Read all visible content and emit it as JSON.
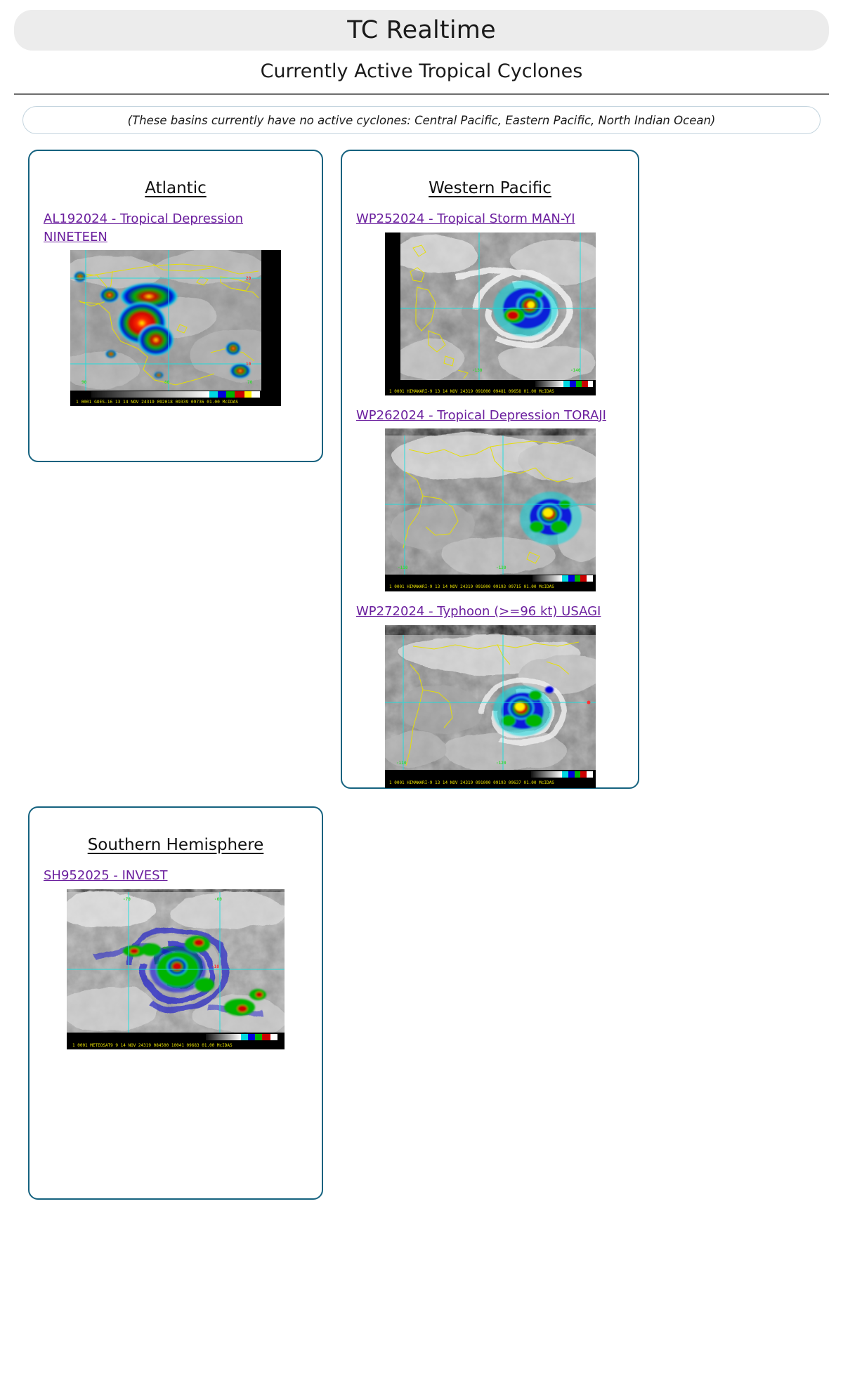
{
  "header": {
    "title": "TC Realtime",
    "subtitle": "Currently Active Tropical Cyclones",
    "note": "(These basins currently have no active cyclones: Central Pacific, Eastern Pacific, North Indian Ocean)"
  },
  "colors": {
    "panel_border": "#15627f",
    "link": "#6b1f9e",
    "title_pill_bg": "#ececec",
    "rule": "#6e6e6e",
    "note_border": "#c3d4de"
  },
  "basins": [
    {
      "id": "atlantic",
      "heading": "Atlantic",
      "storms": [
        {
          "id": "AL192024",
          "link_label": "AL192024 - Tropical Depression NINETEEN",
          "caption": "1 0001  GOES-16      13 14 NOV 24319 092018 09339 09736 01.00      McIDAS",
          "lat_labels": [
            "20",
            "10"
          ],
          "lon_labels": [
            "90",
            "80",
            "70"
          ]
        }
      ]
    },
    {
      "id": "wpac",
      "heading": "Western Pacific",
      "storms": [
        {
          "id": "WP252024",
          "link_label": "WP252024 - Tropical Storm MAN-YI",
          "caption": "1 0001  HIMAWARI-9 13 14 NOV 24319 091000 09481 09658 01.00    McIDAS",
          "lat_labels": [],
          "lon_labels": [
            "-130",
            "-140"
          ]
        },
        {
          "id": "WP262024",
          "link_label": "WP262024 - Tropical Depression TORAJI",
          "caption": "1 0001  HIMAWARI-9 13 14 NOV 24319 091000 09193 09715 01.00    McIDAS",
          "lat_labels": [],
          "lon_labels": [
            "-110",
            "-120"
          ]
        },
        {
          "id": "WP272024",
          "link_label": "WP272024 - Typhoon (>=96 kt) USAGI",
          "caption": "1 0001  HIMAWARI-9 13 14 NOV 24319 091000 09193 09637 01.00    McIDAS",
          "lat_labels": [],
          "lon_labels": [
            "-110",
            "-120"
          ]
        }
      ]
    },
    {
      "id": "sh",
      "heading": "Southern Hemisphere",
      "storms": [
        {
          "id": "SH952025",
          "link_label": "SH952025 - INVEST",
          "caption": "1 0001  METEOSAT9    9 14 NOV 24319 084500 10041 09683 01.00     McIDAS",
          "lat_labels": [
            "-10"
          ],
          "lon_labels": [
            "-70",
            "-60"
          ]
        }
      ]
    }
  ]
}
